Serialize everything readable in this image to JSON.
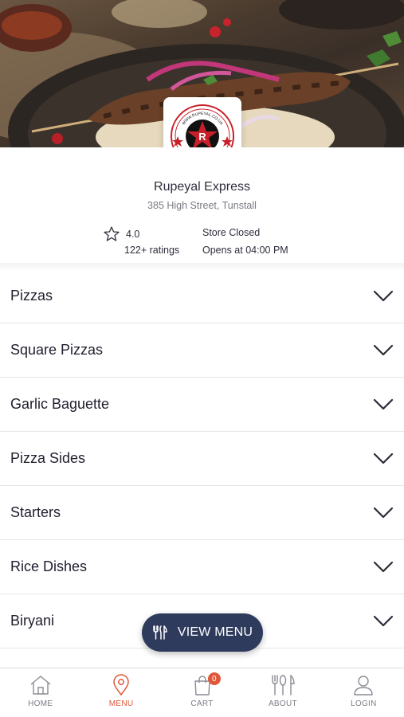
{
  "store": {
    "name": "Rupeyal Express",
    "address": "385 High Street, Tunstall",
    "rating": "4.0",
    "rating_count": "122+ ratings",
    "status": "Store Closed",
    "opens": "Opens at 04:00 PM",
    "logo": {
      "top_text": "WWW.RUPEYAL.CO.UK",
      "bottom_text": "01782790400",
      "letter": "R",
      "colors": {
        "red": "#c8202a",
        "black": "#111111"
      }
    }
  },
  "categories": [
    {
      "label": "Pizzas"
    },
    {
      "label": "Square Pizzas"
    },
    {
      "label": "Garlic Baguette"
    },
    {
      "label": "Pizza Sides"
    },
    {
      "label": "Starters"
    },
    {
      "label": "Rice Dishes"
    },
    {
      "label": "Biryani"
    }
  ],
  "view_menu": {
    "label": "VIEW MENU",
    "icon": "cutlery-icon"
  },
  "tabbar": {
    "items": [
      {
        "label": "HOME",
        "icon": "home-icon"
      },
      {
        "label": "MENU",
        "icon": "location-pin-icon",
        "active": true
      },
      {
        "label": "CART",
        "icon": "shopping-bag-icon",
        "badge": "0"
      },
      {
        "label": "ABOUT",
        "icon": "cutlery-icon"
      },
      {
        "label": "LOGIN",
        "icon": "user-icon"
      }
    ]
  },
  "colors": {
    "accent": "#e0573a",
    "button_bg": "#2f3b5c",
    "text": "#2e2e3e",
    "muted": "#7a7a86"
  }
}
